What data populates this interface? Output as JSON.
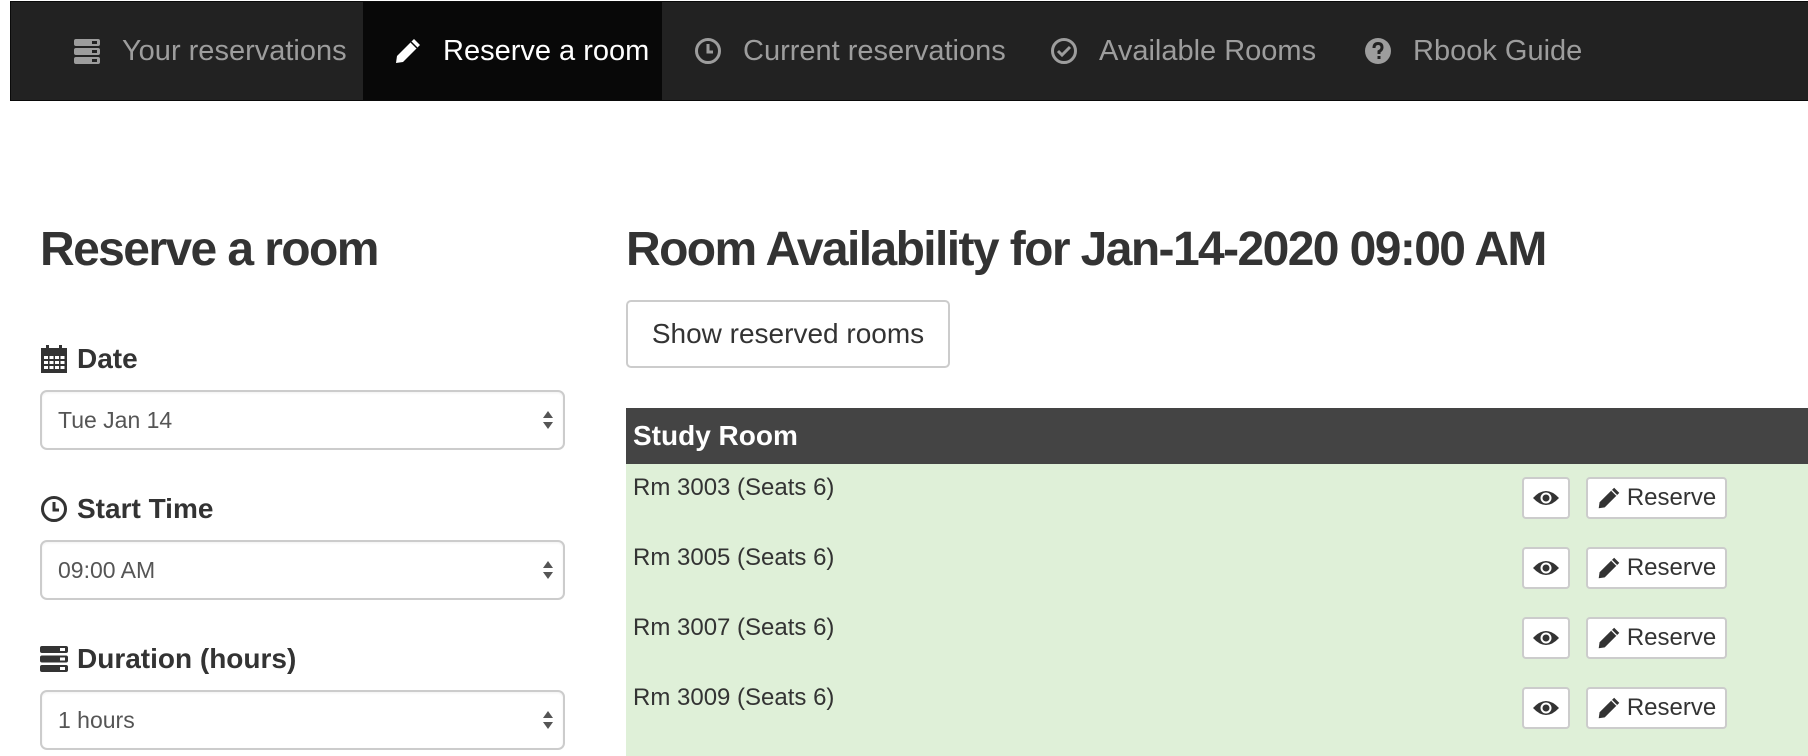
{
  "nav": {
    "items": [
      {
        "label": "Your reservations",
        "icon": "server-icon",
        "active": false
      },
      {
        "label": "Reserve a room",
        "icon": "pencil-icon",
        "active": true
      },
      {
        "label": "Current reservations",
        "icon": "clock-icon",
        "active": false
      },
      {
        "label": "Available Rooms",
        "icon": "check-circle-icon",
        "active": false
      },
      {
        "label": "Rbook Guide",
        "icon": "question-circle-icon",
        "active": false
      }
    ]
  },
  "form": {
    "heading": "Reserve a room",
    "date_label": "Date",
    "date_value": "Tue Jan 14",
    "start_time_label": "Start Time",
    "start_time_value": "09:00 AM",
    "duration_label": "Duration (hours)",
    "duration_value": "1 hours"
  },
  "availability": {
    "heading": "Room Availability for Jan-14-2020 09:00 AM",
    "show_reserved_label": "Show reserved rooms",
    "table_header": "Study Room",
    "reserve_label": "Reserve",
    "rooms": [
      {
        "name": "Rm 3003 (Seats 6)"
      },
      {
        "name": "Rm 3005 (Seats 6)"
      },
      {
        "name": "Rm 3007 (Seats 6)"
      },
      {
        "name": "Rm 3009 (Seats 6)"
      }
    ]
  },
  "colors": {
    "navbar_bg": "#222222",
    "navbar_active_bg": "#080808",
    "nav_text": "#9d9d9d",
    "table_header_bg": "#444444",
    "available_row_bg": "#dff0d8"
  }
}
